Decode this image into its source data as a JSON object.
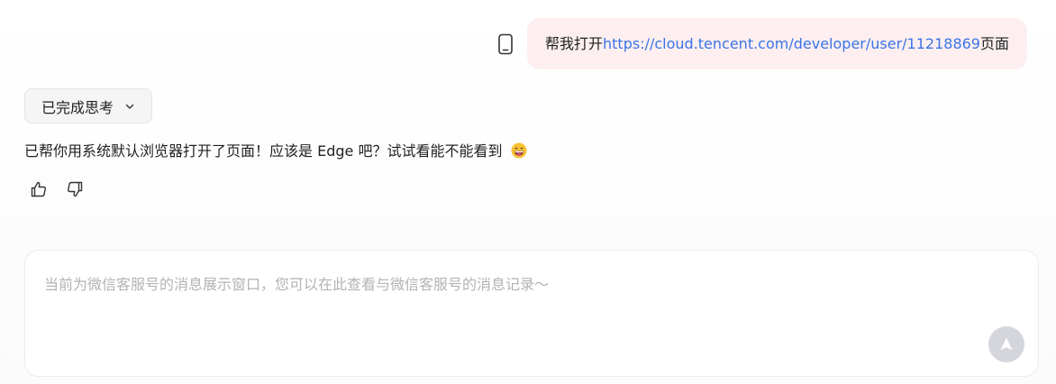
{
  "user_message": {
    "prefix": "帮我打开",
    "link": "https://cloud.tencent.com/developer/user/11218869",
    "suffix": "页面",
    "source_icon": "phone-icon"
  },
  "thinking": {
    "label": "已完成思考",
    "toggle_icon": "chevron-down-icon"
  },
  "assistant_message": {
    "text": "已帮你用系统默认浏览器打开了页面！应该是 Edge 吧？试试看能不能看到",
    "emoji": "grinning-face-emoji"
  },
  "feedback": {
    "like_icon": "thumbs-up-icon",
    "dislike_icon": "thumbs-down-icon"
  },
  "input": {
    "placeholder": "当前为微信客服号的消息展示窗口，您可以在此查看与微信客服号的消息记录～",
    "send_icon": "send-arrow-icon"
  },
  "colors": {
    "user_bubble_bg": "#fdeff0",
    "link": "#3b74e6",
    "placeholder": "#b3b3b3",
    "send_button_disabled": "#d4d6dc"
  }
}
